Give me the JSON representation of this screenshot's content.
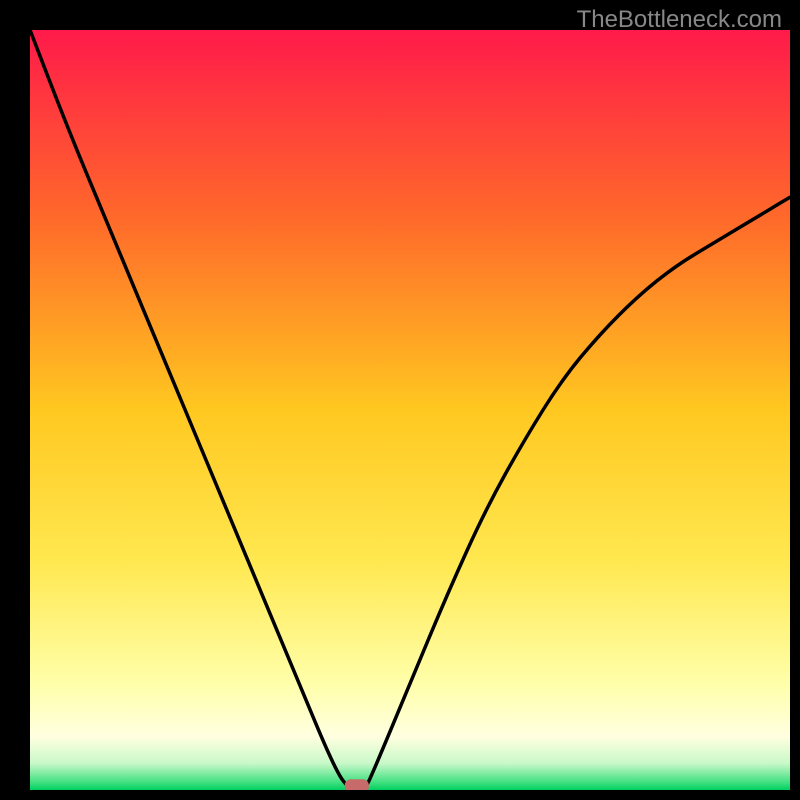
{
  "watermark": "TheBottleneck.com",
  "chart_data": {
    "type": "line",
    "title": "",
    "xlabel": "",
    "ylabel": "",
    "xlim": [
      0,
      100
    ],
    "ylim": [
      0,
      100
    ],
    "series": [
      {
        "name": "curve",
        "x": [
          0,
          5,
          10,
          15,
          20,
          25,
          30,
          35,
          40,
          42,
          44,
          45,
          50,
          55,
          60,
          65,
          70,
          75,
          80,
          85,
          90,
          95,
          100
        ],
        "values": [
          100,
          87,
          75,
          63,
          51,
          39,
          27,
          15,
          3,
          0,
          0,
          2,
          14,
          26,
          37,
          46,
          54,
          60,
          65,
          69,
          72,
          75,
          78
        ]
      }
    ],
    "marker": {
      "x": 43,
      "y": 0.5,
      "color": "#c76a6a"
    },
    "gradient_stops": [
      {
        "offset": 0.0,
        "color": "#ff1a4a"
      },
      {
        "offset": 0.25,
        "color": "#ff6a2a"
      },
      {
        "offset": 0.5,
        "color": "#ffc820"
      },
      {
        "offset": 0.7,
        "color": "#ffe850"
      },
      {
        "offset": 0.86,
        "color": "#ffffaa"
      },
      {
        "offset": 0.93,
        "color": "#ffffe0"
      },
      {
        "offset": 0.965,
        "color": "#c8f8c8"
      },
      {
        "offset": 0.99,
        "color": "#40e080"
      },
      {
        "offset": 1.0,
        "color": "#00d060"
      }
    ]
  }
}
